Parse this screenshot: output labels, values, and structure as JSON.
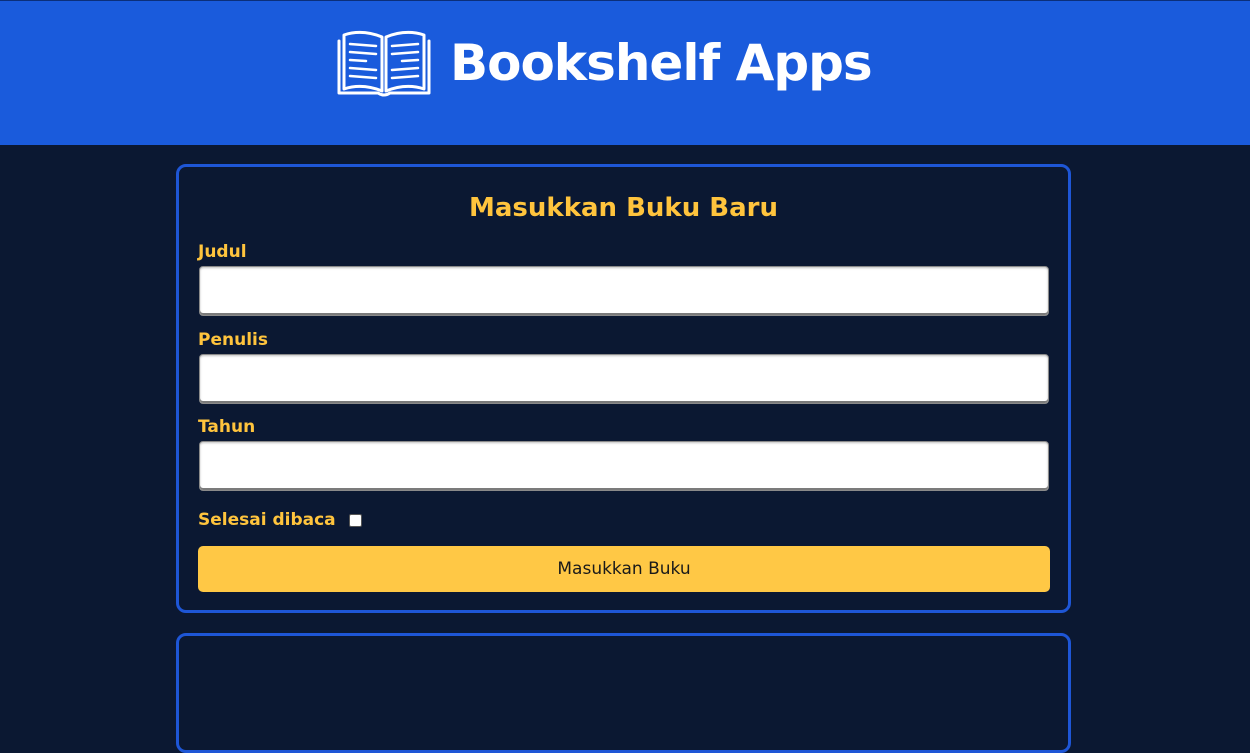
{
  "header": {
    "title": "Bookshelf Apps",
    "icon": "open-book-icon"
  },
  "form": {
    "title": "Masukkan Buku Baru",
    "fields": [
      {
        "label": "Judul",
        "value": "",
        "placeholder": ""
      },
      {
        "label": "Penulis",
        "value": "",
        "placeholder": ""
      },
      {
        "label": "Tahun",
        "value": "",
        "placeholder": ""
      }
    ],
    "checkbox": {
      "label": "Selesai dibaca",
      "checked": false
    },
    "submit_label": "Masukkan Buku"
  },
  "colors": {
    "header_bg": "#1a5bdc",
    "page_bg": "#0b1832",
    "accent": "#ffc43d",
    "card_border": "#1e56d6",
    "button_bg": "#ffc845"
  }
}
